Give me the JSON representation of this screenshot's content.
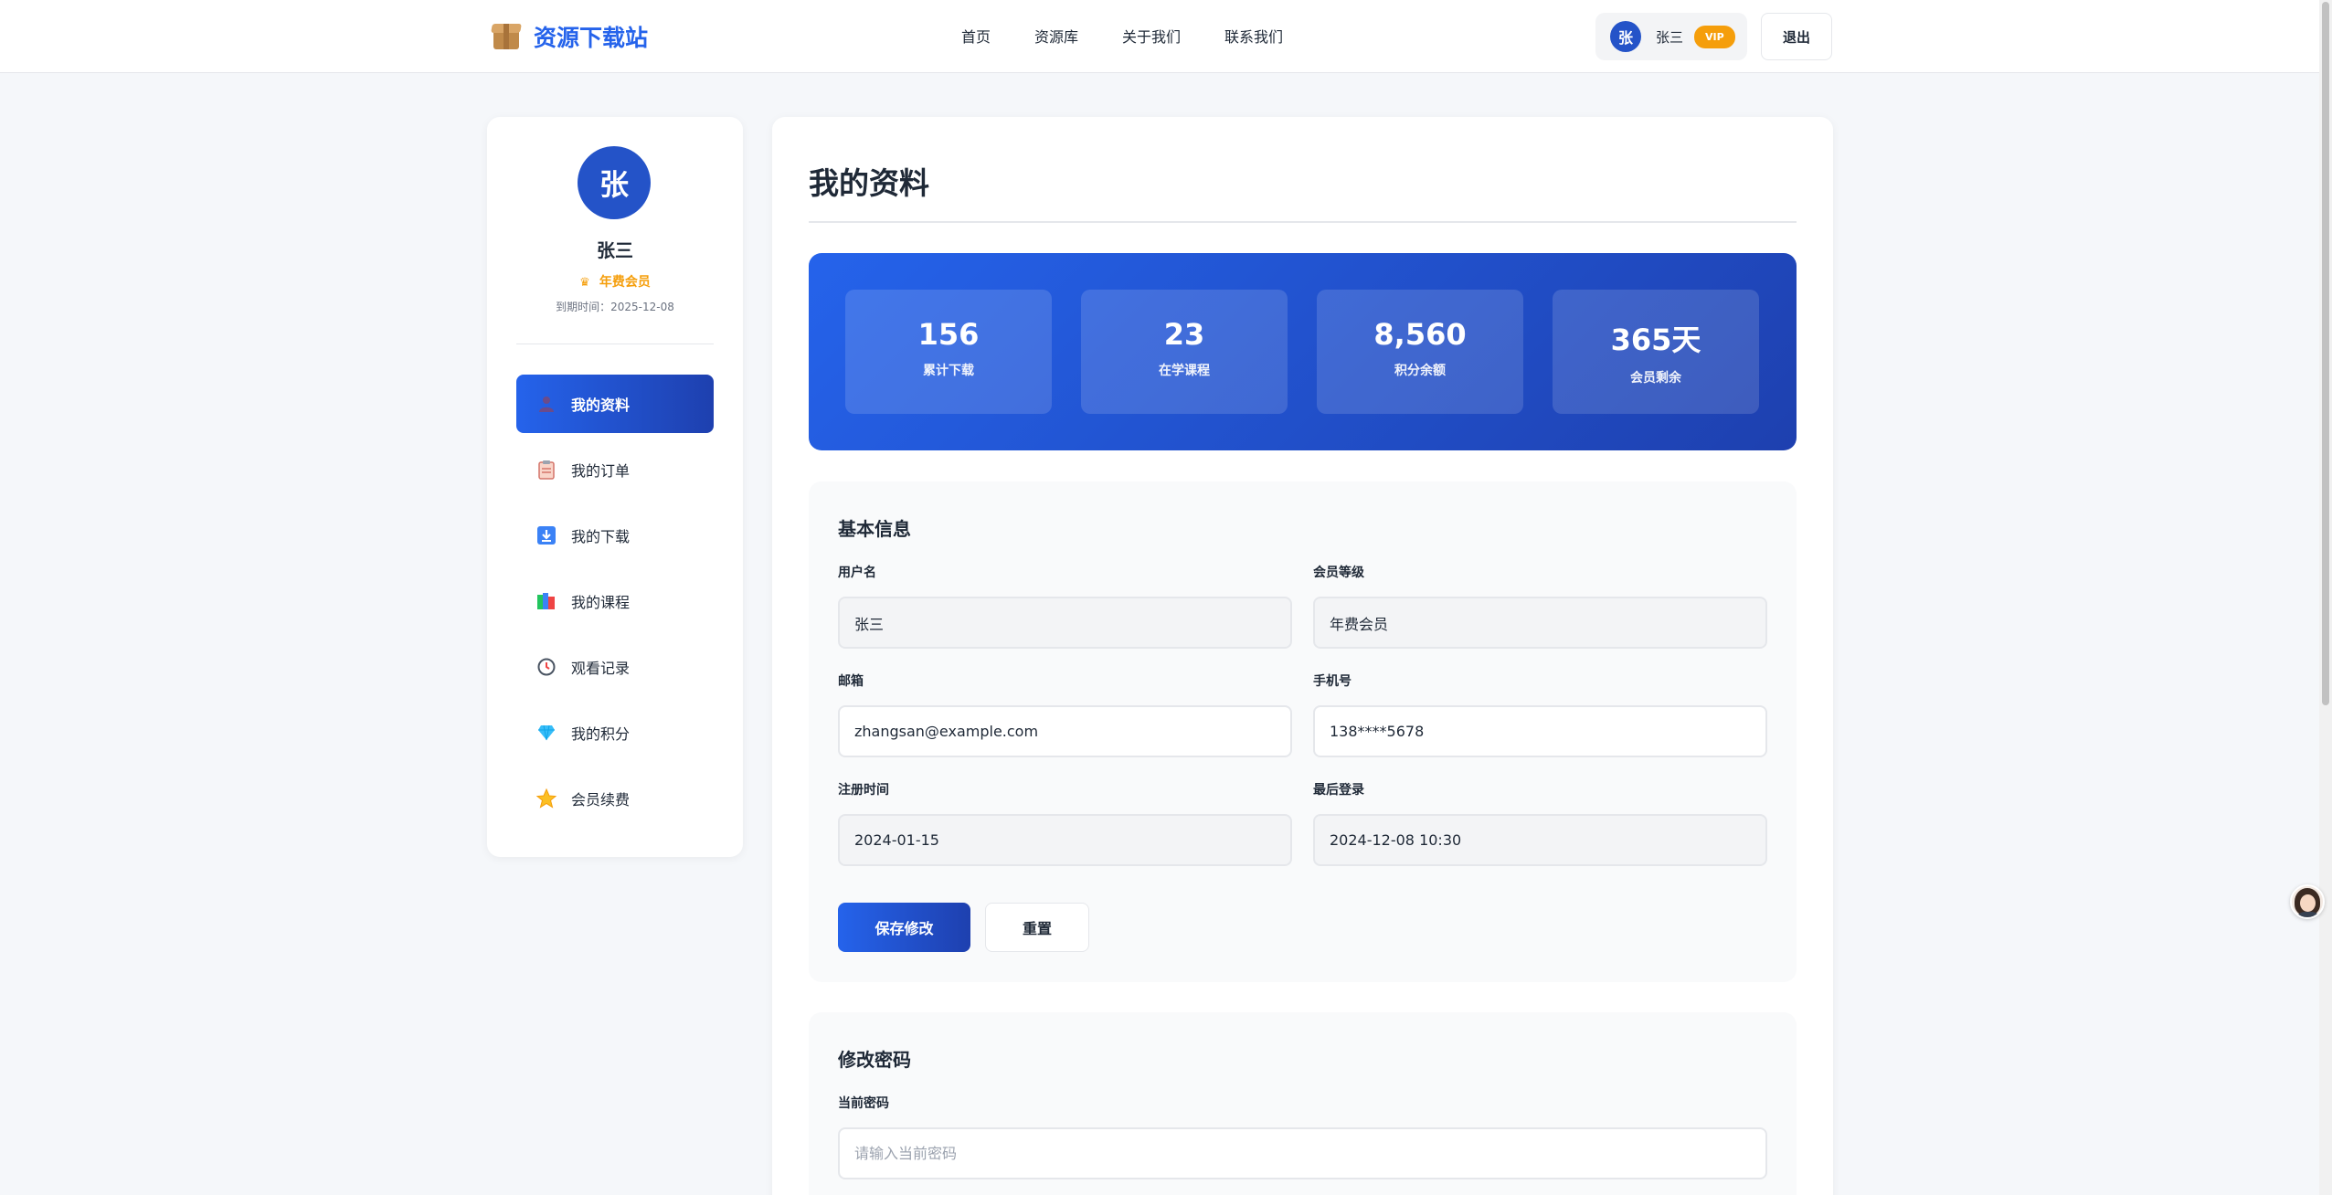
{
  "header": {
    "logo_text": "资源下载站",
    "nav": [
      "首页",
      "资源库",
      "关于我们",
      "联系我们"
    ],
    "user_avatar_char": "张",
    "user_name": "张三",
    "vip_label": "VIP",
    "logout_label": "退出"
  },
  "sidebar": {
    "avatar_char": "张",
    "name": "张三",
    "member_label": "年费会员",
    "expire_text": "到期时间：2025-12-08",
    "items": [
      {
        "label": "我的资料",
        "icon": "user-icon"
      },
      {
        "label": "我的订单",
        "icon": "clipboard-icon"
      },
      {
        "label": "我的下载",
        "icon": "download-icon"
      },
      {
        "label": "我的课程",
        "icon": "books-icon"
      },
      {
        "label": "观看记录",
        "icon": "clock-icon"
      },
      {
        "label": "我的积分",
        "icon": "diamond-icon"
      },
      {
        "label": "会员续费",
        "icon": "star-icon"
      }
    ]
  },
  "main": {
    "title": "我的资料",
    "stats": [
      {
        "value": "156",
        "label": "累计下载"
      },
      {
        "value": "23",
        "label": "在学课程"
      },
      {
        "value": "8,560",
        "label": "积分余额"
      },
      {
        "value": "365天",
        "label": "会员剩余"
      }
    ],
    "basic": {
      "title": "基本信息",
      "username_label": "用户名",
      "username_value": "张三",
      "level_label": "会员等级",
      "level_value": "年费会员",
      "email_label": "邮箱",
      "email_value": "zhangsan@example.com",
      "phone_label": "手机号",
      "phone_value": "138****5678",
      "register_label": "注册时间",
      "register_value": "2024-01-15",
      "lastlogin_label": "最后登录",
      "lastlogin_value": "2024-12-08 10:30",
      "save_label": "保存修改",
      "reset_label": "重置"
    },
    "password": {
      "title": "修改密码",
      "current_label": "当前密码",
      "current_placeholder": "请输入当前密码"
    }
  },
  "colors": {
    "primary": "#2563eb",
    "primary_dark": "#1e40af",
    "vip": "#f59e0b"
  }
}
